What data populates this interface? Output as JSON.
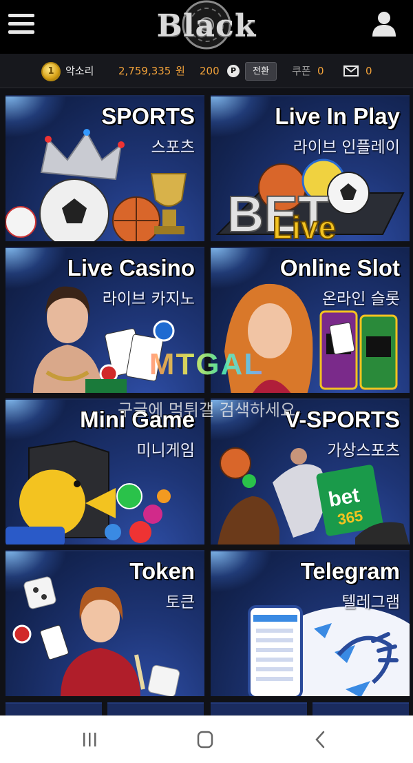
{
  "header": {
    "logo_text": "Black",
    "menu_icon": "hamburger-menu-icon",
    "user_icon": "user-profile-icon"
  },
  "account": {
    "level_badge": "1",
    "username": "악소리",
    "balance": "2,759,335",
    "balance_unit": "원",
    "points": "200",
    "points_badge": "P",
    "convert_label": "전환",
    "coupon_label": "쿠폰",
    "coupon_count": "0",
    "mail_icon": "mail-icon",
    "mail_count": "0"
  },
  "games": [
    {
      "title": "SPORTS",
      "subtitle": "스포츠"
    },
    {
      "title": "Live In Play",
      "subtitle": "라이브 인플레이"
    },
    {
      "title": "Live Casino",
      "subtitle": "라이브 카지노"
    },
    {
      "title": "Online Slot",
      "subtitle": "온라인 슬롯"
    },
    {
      "title": "Mini Game",
      "subtitle": "미니게임"
    },
    {
      "title": "V-SPORTS",
      "subtitle": "가상스포츠"
    },
    {
      "title": "Token",
      "subtitle": "토큰"
    },
    {
      "title": "Telegram",
      "subtitle": "텔레그램"
    }
  ],
  "artwork": {
    "live_bet_big": "BET",
    "live_bet_small": "Live",
    "vsports_bet": "bet",
    "vsports_num": "365"
  },
  "watermark": {
    "logo": "MTGAL",
    "text": "구글에 먹튀갤 검색하세요"
  },
  "system_nav": {
    "recents_icon": "recents-icon",
    "home_icon": "home-icon",
    "back_icon": "back-icon"
  },
  "colors": {
    "accent_orange": "#f2a23a",
    "header_bg": "#000000",
    "card_blue": "#1e3576"
  }
}
